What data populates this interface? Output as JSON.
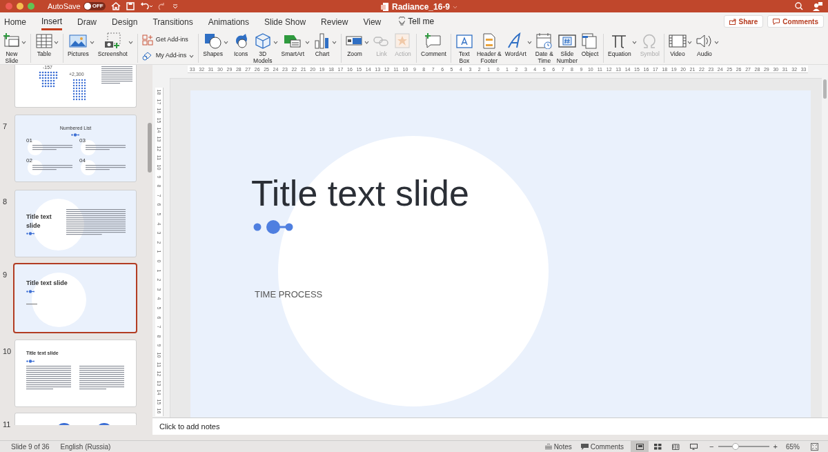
{
  "title_bar": {
    "autosave_label": "AutoSave",
    "autosave_toggle": {
      "label": "OFF",
      "on": false
    },
    "document_title": "Radiance_16-9"
  },
  "tabs": [
    {
      "label": "Home",
      "selected": false
    },
    {
      "label": "Insert",
      "selected": true
    },
    {
      "label": "Draw",
      "selected": false
    },
    {
      "label": "Design",
      "selected": false
    },
    {
      "label": "Transitions",
      "selected": false
    },
    {
      "label": "Animations",
      "selected": false
    },
    {
      "label": "Slide Show",
      "selected": false
    },
    {
      "label": "Review",
      "selected": false
    },
    {
      "label": "View",
      "selected": false
    }
  ],
  "tell_me": "Tell me",
  "share_button": "Share",
  "comments_button": "Comments",
  "ribbon_groups": [
    {
      "items": [
        {
          "kind": "newslide",
          "lines": [
            "New",
            "Slide"
          ],
          "dropdown": true,
          "disabled": false
        }
      ]
    },
    {
      "items": [
        {
          "kind": "table",
          "lines": [
            "Table"
          ],
          "dropdown": true,
          "disabled": false
        }
      ]
    },
    {
      "items": [
        {
          "kind": "pictures",
          "lines": [
            "Pictures"
          ],
          "dropdown": true,
          "disabled": false
        },
        {
          "kind": "screenshot",
          "lines": [
            "Screenshot"
          ],
          "dropdown": true,
          "disabled": false
        }
      ]
    },
    {
      "rows": [
        {
          "kind": "getaddins",
          "label": "Get Add-ins",
          "dropdown": false
        },
        {
          "kind": "myaddins",
          "label": "My Add-ins",
          "dropdown": true
        }
      ]
    },
    {
      "items": [
        {
          "kind": "shapes",
          "lines": [
            "Shapes"
          ],
          "dropdown": true,
          "disabled": false
        },
        {
          "kind": "icons",
          "lines": [
            "Icons"
          ],
          "dropdown": false,
          "disabled": false
        },
        {
          "kind": "models",
          "lines": [
            "3D",
            "Models"
          ],
          "dropdown": true,
          "disabled": false
        },
        {
          "kind": "smartart",
          "lines": [
            "SmartArt"
          ],
          "dropdown": true,
          "disabled": false
        },
        {
          "kind": "chart",
          "lines": [
            "Chart"
          ],
          "dropdown": true,
          "disabled": false
        }
      ]
    },
    {
      "items": [
        {
          "kind": "zoom",
          "lines": [
            "Zoom"
          ],
          "dropdown": true,
          "disabled": false
        },
        {
          "kind": "link",
          "lines": [
            "Link"
          ],
          "dropdown": false,
          "disabled": true
        },
        {
          "kind": "action",
          "lines": [
            "Action"
          ],
          "dropdown": false,
          "disabled": true
        }
      ]
    },
    {
      "items": [
        {
          "kind": "comment",
          "lines": [
            "Comment"
          ],
          "dropdown": false,
          "disabled": false
        }
      ]
    },
    {
      "items": [
        {
          "kind": "textbox",
          "lines": [
            "Text",
            "Box"
          ],
          "dropdown": false,
          "disabled": false
        },
        {
          "kind": "header",
          "lines": [
            "Header &",
            "Footer"
          ],
          "dropdown": false,
          "disabled": false
        },
        {
          "kind": "wordart",
          "lines": [
            "WordArt"
          ],
          "dropdown": true,
          "disabled": false
        },
        {
          "kind": "datetime",
          "lines": [
            "Date &",
            "Time"
          ],
          "dropdown": false,
          "disabled": false
        },
        {
          "kind": "slidenumber",
          "lines": [
            "Slide",
            "Number"
          ],
          "dropdown": false,
          "disabled": false
        },
        {
          "kind": "object",
          "lines": [
            "Object"
          ],
          "dropdown": false,
          "disabled": false
        }
      ]
    },
    {
      "items": [
        {
          "kind": "equation",
          "lines": [
            "Equation"
          ],
          "dropdown": true,
          "disabled": false
        },
        {
          "kind": "symbol",
          "lines": [
            "Symbol"
          ],
          "dropdown": false,
          "disabled": true
        }
      ]
    },
    {
      "items": [
        {
          "kind": "video",
          "lines": [
            "Video"
          ],
          "dropdown": true,
          "disabled": false
        },
        {
          "kind": "audio",
          "lines": [
            "Audio"
          ],
          "dropdown": true,
          "disabled": false
        }
      ]
    }
  ],
  "horizontal_ruler": [
    "33",
    "32",
    "31",
    "30",
    "29",
    "28",
    "27",
    "26",
    "25",
    "24",
    "23",
    "22",
    "21",
    "20",
    "19",
    "18",
    "17",
    "16",
    "15",
    "14",
    "13",
    "12",
    "11",
    "10",
    "9",
    "8",
    "7",
    "6",
    "5",
    "4",
    "3",
    "2",
    "1",
    "0",
    "1",
    "2",
    "3",
    "4",
    "5",
    "6",
    "7",
    "8",
    "9",
    "10",
    "11",
    "12",
    "13",
    "14",
    "15",
    "16",
    "17",
    "18",
    "19",
    "20",
    "21",
    "22",
    "23",
    "24",
    "25",
    "26",
    "27",
    "28",
    "29",
    "30",
    "31",
    "32",
    "33"
  ],
  "vertical_ruler": [
    "18",
    "17",
    "16",
    "15",
    "14",
    "13",
    "12",
    "11",
    "10",
    "9",
    "8",
    "7",
    "6",
    "5",
    "4",
    "3",
    "2",
    "1",
    "0",
    "1",
    "2",
    "3",
    "4",
    "5",
    "6",
    "7",
    "8",
    "9",
    "10",
    "11",
    "12",
    "13",
    "14",
    "15",
    "16"
  ],
  "thumbnails": [
    {
      "kind": "stats",
      "selected": false,
      "stats": [
        "-157",
        "+2,300"
      ]
    },
    {
      "kind": "numbered",
      "number": "7",
      "selected": false,
      "title": "Numbered List",
      "list_numbers": [
        "01",
        "03",
        "02",
        "04"
      ]
    },
    {
      "kind": "title_left",
      "number": "8",
      "selected": false,
      "title": "Title text slide"
    },
    {
      "kind": "title_circle",
      "number": "9",
      "selected": true,
      "title": "Title text slide"
    },
    {
      "kind": "title_columns",
      "number": "10",
      "selected": false,
      "title": "Title text slide"
    },
    {
      "kind": "partial",
      "number": "11",
      "selected": false
    }
  ],
  "slide": {
    "title": "Title text slide",
    "subtitle": "TIME PROCESS"
  },
  "notes_placeholder": "Click to add notes",
  "status_bar": {
    "slide_info": "Slide 9 of 36",
    "language": "English (Russia)",
    "notes": "Notes",
    "comments": "Comments",
    "views": [
      {
        "kind": "normal",
        "selected": true
      },
      {
        "kind": "sorter",
        "selected": false
      },
      {
        "kind": "reading",
        "selected": false
      },
      {
        "kind": "slideshow",
        "selected": false
      }
    ],
    "zoom_minus": "−",
    "zoom_plus": "+",
    "zoom": {
      "level": 0.34
    },
    "zoom_percent": "65%"
  }
}
